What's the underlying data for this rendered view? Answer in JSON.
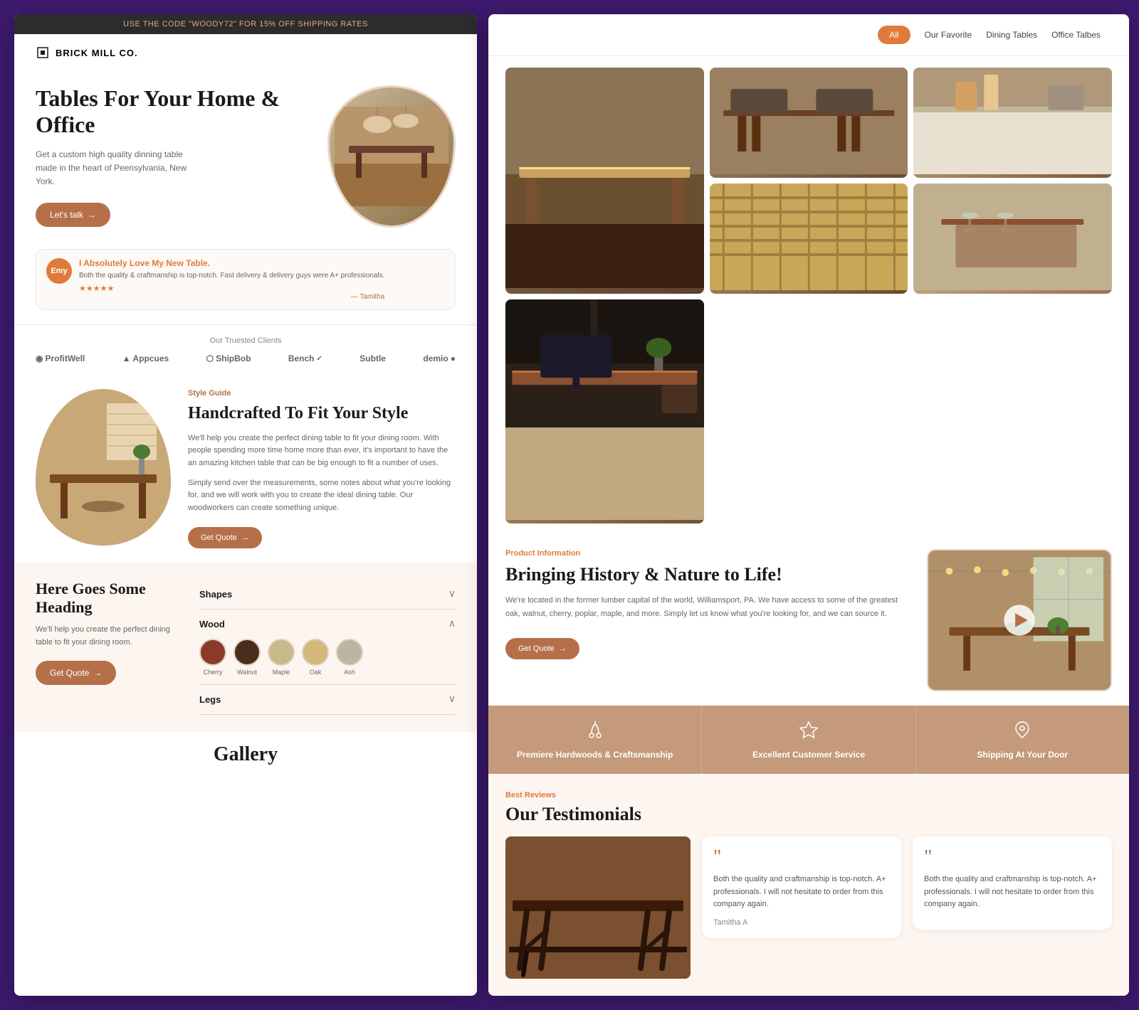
{
  "promo": {
    "text": "USE THE CODE ",
    "code": "\"WOODY72\" FOR 15% OFF SHIPPING RATES"
  },
  "brand": {
    "name": "BRICK MILL CO.",
    "logo_char": "◈"
  },
  "hero": {
    "title": "Tables For Your Home & Office",
    "subtitle": "Get a custom high quality dinning table made in the heart of Peensylvania, New York.",
    "cta": "Let's talk"
  },
  "review": {
    "avatar_text": "Emy",
    "title": "I Absolutely Love My New Table.",
    "text": "Both the quality & craftmanship is top-notch. Fast delivery & delivery guys were A+ professionals.",
    "stars": "★★★★★",
    "author": "— Tamitha"
  },
  "clients": {
    "label": "Our Truested Clients",
    "logos": [
      {
        "name": "ProfitWell",
        "icon": "◉"
      },
      {
        "name": "Appcues",
        "icon": "▲"
      },
      {
        "name": "ShipBob",
        "icon": "⬡"
      },
      {
        "name": "Bench",
        "icon": "Bench"
      },
      {
        "name": "Subtle",
        "icon": "Subtle"
      },
      {
        "name": "demio",
        "icon": "demio"
      }
    ]
  },
  "style_guide": {
    "tag": "Style Guide",
    "title": "Handcrafted To Fit Your Style",
    "text1": "We'll help you create the perfect dining table to fit your dining room. With people spending more time home more than ever, it's important to have the an amazing kitchen table that can be big enough to fit a number of uses.",
    "text2": "Simply send over the measurements, some notes about what you're looking for, and we will work with you to create the ideal dining table. Our woodworkers can create something unique.",
    "cta": "Get Quote"
  },
  "bottom_left": {
    "title": "Here Goes Some Heading",
    "text": "We'll help you create the perfect dining table to fit your dining room.",
    "cta": "Get Quote"
  },
  "accordion": {
    "items": [
      {
        "label": "Shapes",
        "open": false
      },
      {
        "label": "Wood",
        "open": true,
        "swatches": [
          {
            "color": "#8B3A2A",
            "label": "Cherry"
          },
          {
            "color": "#4A2D1A",
            "label": "Walnut"
          },
          {
            "color": "#C8B98A",
            "label": "Maple"
          },
          {
            "color": "#D4B87A",
            "label": "Oak"
          },
          {
            "color": "#BDB5A0",
            "label": "Ash"
          }
        ]
      },
      {
        "label": "Legs",
        "open": false
      }
    ]
  },
  "gallery": {
    "heading": "Gallery"
  },
  "right_nav": {
    "filter_all": "All",
    "filter_favorite": "Our Favorite",
    "filter_dining": "Dining Tables",
    "filter_office": "Office Talbes"
  },
  "product_info": {
    "tag": "Product Information",
    "title": "Bringing History & Nature to Life!",
    "text": "We're located in the former lumber capital of the world, Williamsport, PA. We have access to some of the greatest oak, walnut, cherry, poplar, maple, and more. Simply let us know what you're looking for, and we can source it.",
    "cta": "Get Quote"
  },
  "features": [
    {
      "icon": "🌲",
      "label": "Premiere Hardwoods & Craftsmanship"
    },
    {
      "icon": "☆",
      "label": "Excellent Customer Service"
    },
    {
      "icon": "📍",
      "label": "Shipping At Your Door"
    }
  ],
  "testimonials": {
    "tag": "Best Reviews",
    "title": "Our Testimonials",
    "cards": [
      {
        "text": "Both the quality and craftmanship is top-notch. A+ professionals. I will not hesitate to order from this company again.",
        "author": "Tamitha A"
      },
      {
        "text": "Both the quality and craftmanship is top-notch. A+ professionals. I will not hesitate to order from this company again.",
        "author": ""
      }
    ]
  }
}
